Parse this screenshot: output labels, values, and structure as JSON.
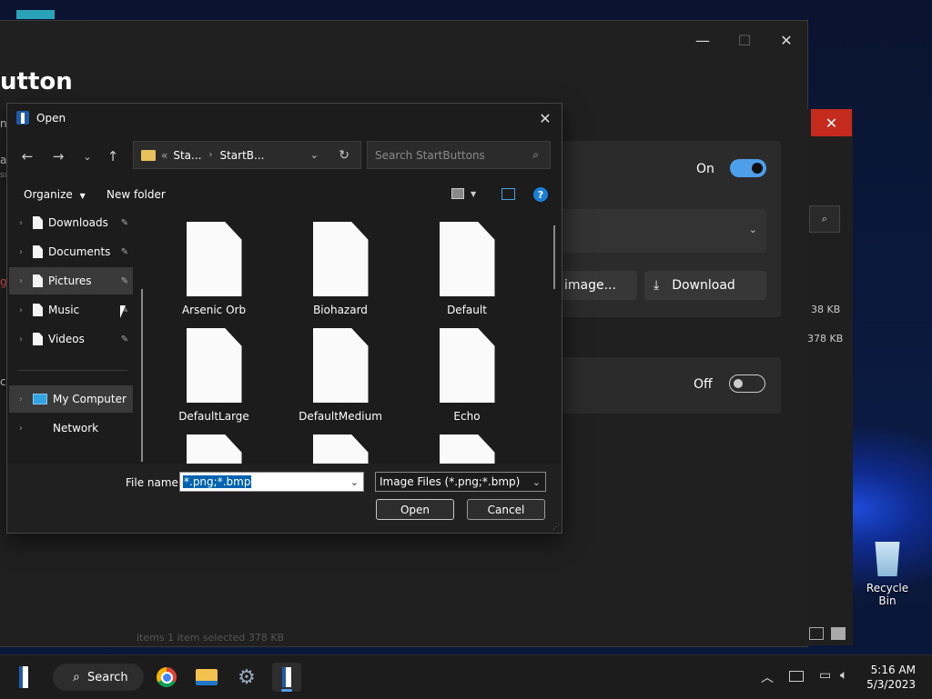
{
  "background_app": {
    "title_partial": "utton",
    "left_fragments": [
      "ne",
      "a",
      "su",
      "ge",
      "ci"
    ],
    "toggle_on_label": "On",
    "toggle_off_label": "Off",
    "image_button_label": "image...",
    "download_button_label": "Download",
    "size_1": "38 KB",
    "size_2": "378 KB",
    "status_partial": "items   1 item selected  378 KB"
  },
  "dialog": {
    "title": "Open",
    "address": {
      "prefix": "«",
      "crumbs": [
        "Sta...",
        "StartB..."
      ]
    },
    "search_placeholder": "Search StartButtons",
    "toolbar": {
      "organize_label": "Organize",
      "new_folder_label": "New folder"
    },
    "nav_items": [
      {
        "label": "Downloads",
        "pinned": true
      },
      {
        "label": "Documents",
        "pinned": true
      },
      {
        "label": "Pictures",
        "pinned": true,
        "selected": true
      },
      {
        "label": "Music",
        "pinned": true
      },
      {
        "label": "Videos",
        "pinned": true
      }
    ],
    "nav_locations": [
      {
        "label": "My Computer"
      },
      {
        "label": "Network"
      }
    ],
    "files": [
      "Arsenic Orb",
      "Biohazard",
      "Default",
      "DefaultLarge",
      "DefaultMedium",
      "Echo",
      "",
      "",
      ""
    ],
    "filename_label": "File name:",
    "filename_value": "*.png;*.bmp",
    "filetype_value": "Image Files (*.png;*.bmp)",
    "open_button": "Open",
    "cancel_button": "Cancel"
  },
  "taskbar": {
    "search_label": "Search",
    "time": "5:16 AM",
    "date": "5/3/2023"
  },
  "desktop": {
    "recycle_bin_label": "Recycle Bin"
  },
  "colors": {
    "accent": "#4c9fe8",
    "close_red": "#c42b1c",
    "selection": "#0063b1"
  }
}
